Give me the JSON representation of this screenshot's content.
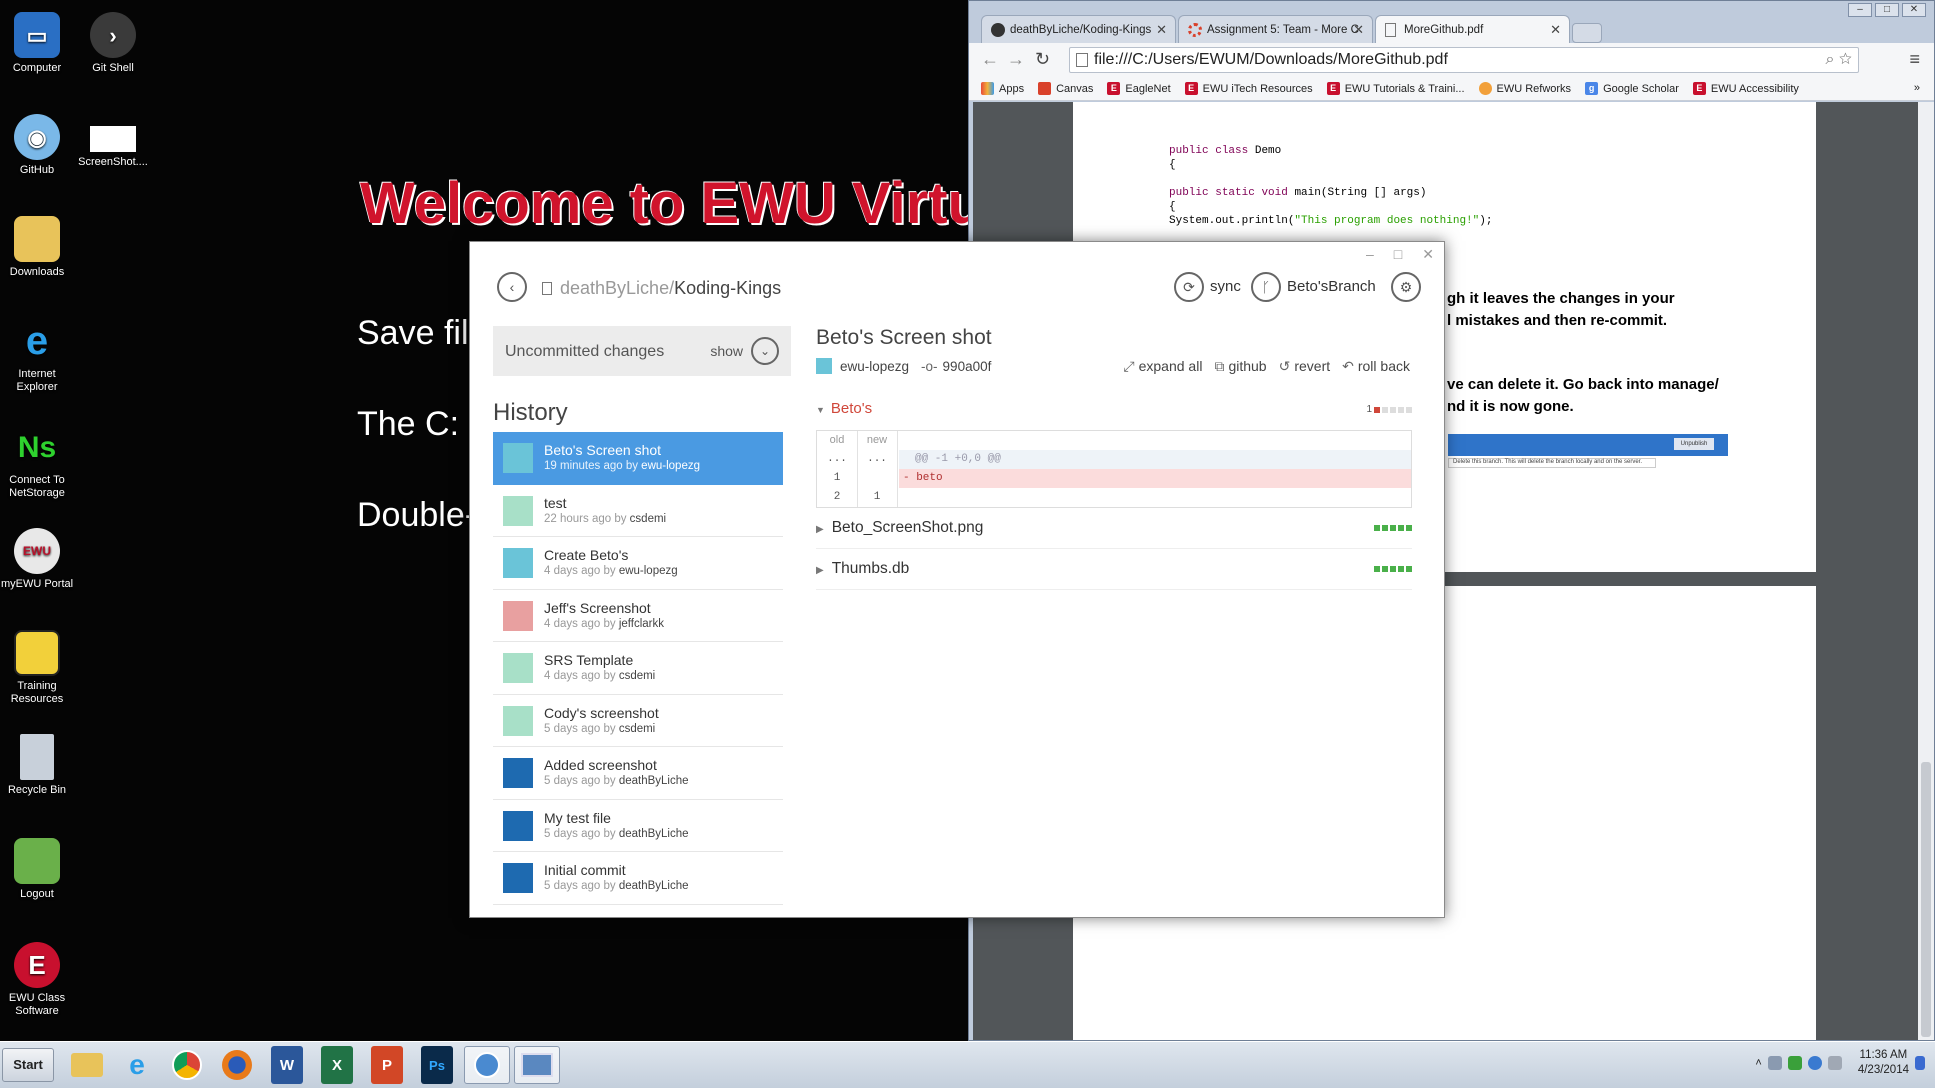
{
  "desktop": {
    "icons": [
      {
        "label": "Computer"
      },
      {
        "label": "Git Shell"
      },
      {
        "label": "GitHub"
      },
      {
        "label": "ScreenShot...."
      },
      {
        "label": "Downloads"
      },
      {
        "label": "Internet Explorer"
      },
      {
        "label": "Connect To NetStorage"
      },
      {
        "label": "myEWU Portal"
      },
      {
        "label": "Training Resources"
      },
      {
        "label": "Recycle Bin"
      },
      {
        "label": "Logout"
      },
      {
        "label": "EWU Class Software"
      }
    ],
    "welcome": "Welcome to EWU Virtua",
    "lines": [
      "Save file",
      "The C: D",
      "Double-"
    ]
  },
  "browser": {
    "tabs": [
      {
        "label": "deathByLiche/Koding-Kings",
        "icon": "github-icon"
      },
      {
        "label": "Assignment 5: Team - More C",
        "icon": "canvas-icon"
      },
      {
        "label": "MoreGithub.pdf",
        "icon": "page-icon"
      }
    ],
    "url": "file:///C:/Users/EWUM/Downloads/MoreGithub.pdf",
    "bookmarks": [
      {
        "label": "Apps"
      },
      {
        "label": "Canvas"
      },
      {
        "label": "EagleNet"
      },
      {
        "label": "EWU iTech Resources"
      },
      {
        "label": "EWU Tutorials & Traini..."
      },
      {
        "label": "EWU Refworks"
      },
      {
        "label": "Google Scholar"
      },
      {
        "label": "EWU Accessibility"
      }
    ],
    "bookmarks_more": "»",
    "pdf": {
      "code": {
        "kw_public": "public",
        "kw_class": "class",
        "class_name": "Demo",
        "brace": "{",
        "kw_static": "static",
        "kw_void": "void",
        "main_sig": "main(String [] args)",
        "println_pre": "System.out.println(",
        "println_str": "\"This program does nothing!\"",
        "println_post": ");"
      },
      "text": [
        "gh it leaves the changes in your",
        "l mistakes and then re-commit.",
        "ve can delete it. Go back into manage/",
        "nd it is now gone."
      ],
      "shot_tip": "Delete this branch. This will delete the branch locally and on the server.",
      "shot_button": "Unpublish"
    }
  },
  "github_app": {
    "repo_owner": "deathByLiche/",
    "repo_name": "Koding-Kings",
    "sync_label": "sync",
    "branch_label": "Beto'sBranch",
    "uncommitted_label": "Uncommitted changes",
    "show_label": "show",
    "history_title": "History",
    "history": [
      {
        "title": "Beto's Screen shot",
        "time": "19 minutes ago by ",
        "author": "ewu-lopezg"
      },
      {
        "title": "test",
        "time": "22 hours ago by ",
        "author": "csdemi"
      },
      {
        "title": "Create Beto's",
        "time": "4 days ago by ",
        "author": "ewu-lopezg"
      },
      {
        "title": "Jeff's Screenshot",
        "time": "4 days ago by ",
        "author": "jeffclarkk"
      },
      {
        "title": "SRS Template",
        "time": "4 days ago by ",
        "author": "csdemi"
      },
      {
        "title": "Cody's screenshot",
        "time": "5 days ago by ",
        "author": "csdemi"
      },
      {
        "title": "Added screenshot",
        "time": "5 days ago by ",
        "author": "deathByLiche"
      },
      {
        "title": "My test file",
        "time": "5 days ago by ",
        "author": "deathByLiche"
      },
      {
        "title": "Initial commit",
        "time": "5 days ago by ",
        "author": "deathByLiche"
      }
    ],
    "commit": {
      "title": "Beto's Screen shot",
      "author": "ewu-lopezg",
      "sha": "990a00f",
      "actions": {
        "expand": "expand all",
        "github": "github",
        "revert": "revert",
        "rollback": "roll back"
      },
      "files": [
        {
          "name": "Beto's",
          "count": "1"
        },
        {
          "name": "Beto_ScreenShot.png"
        },
        {
          "name": "Thumbs.db"
        }
      ],
      "diff": {
        "old_label": "old",
        "new_label": "new",
        "ellipsis": "...",
        "hunk": "@@ -1 +0,0 @@",
        "line1_old": "1",
        "line1_code": "- beto",
        "line2_old": "2",
        "line2_new": "1"
      }
    }
  },
  "taskbar": {
    "start": "Start",
    "time": "11:36 AM",
    "date": "4/23/2014"
  }
}
